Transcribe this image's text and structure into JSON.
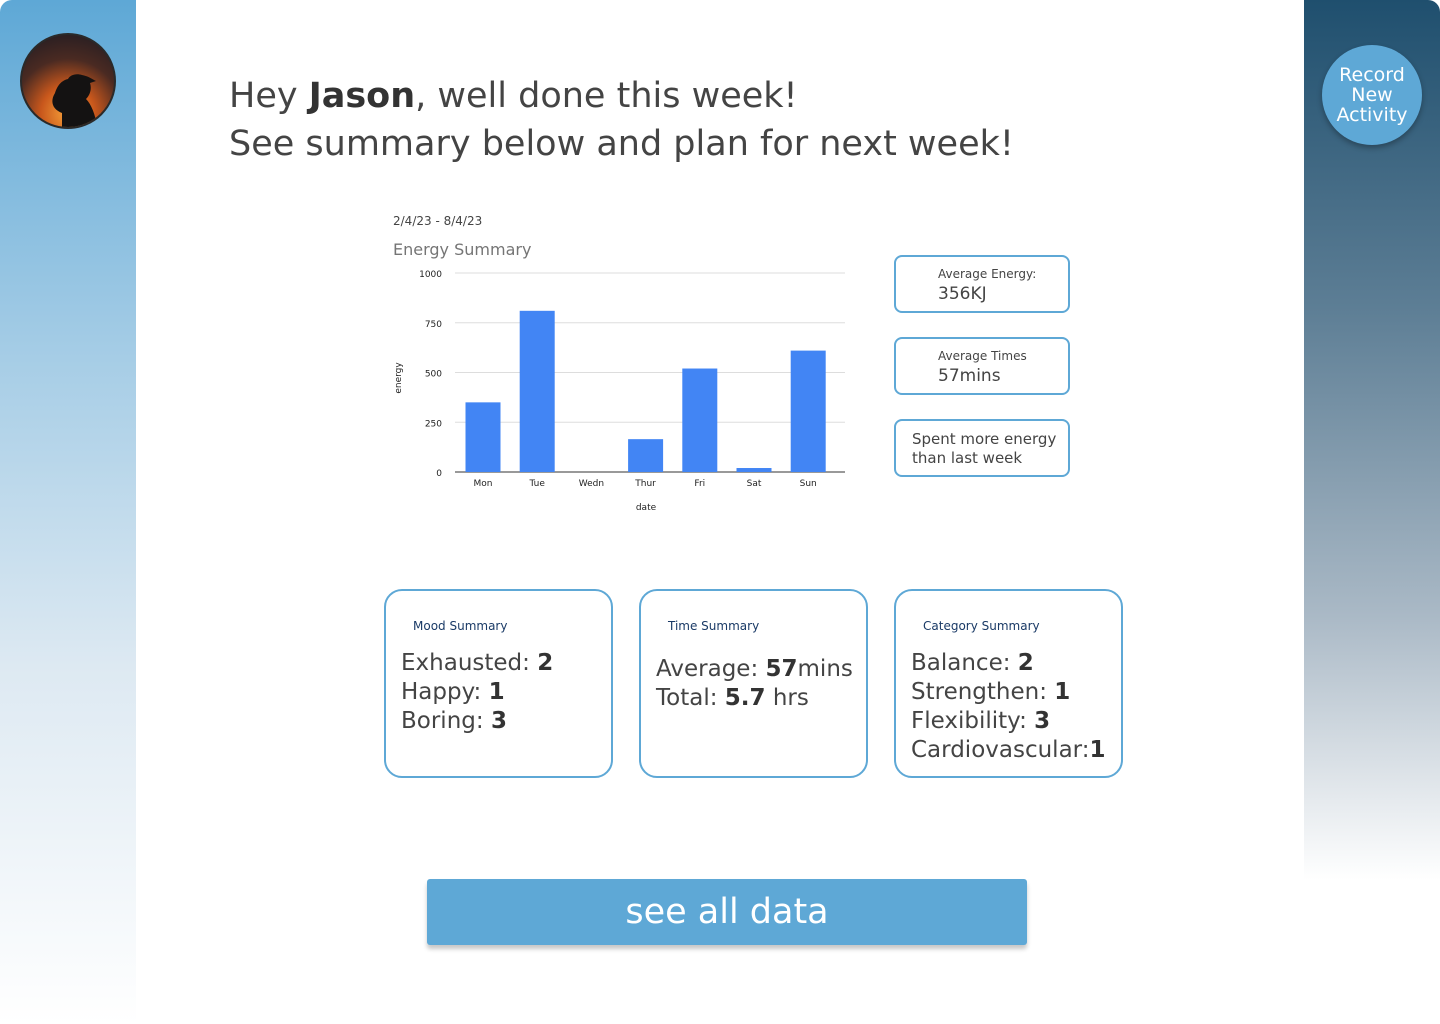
{
  "user": {
    "name": "Jason"
  },
  "greeting": {
    "prefix": "Hey ",
    "suffix": ", well done this week!",
    "line2": "See summary below and plan for next week!"
  },
  "record_button": {
    "line1": "Record",
    "line2": "New",
    "line3": "Activity"
  },
  "date_range": "2/4/23 - 8/4/23",
  "chart_data": {
    "type": "bar",
    "title": "Energy Summary",
    "xlabel": "date",
    "ylabel": "energy",
    "categories": [
      "Mon",
      "Tue",
      "Wedn",
      "Thur",
      "Fri",
      "Sat",
      "Sun"
    ],
    "values": [
      350,
      810,
      0,
      165,
      520,
      20,
      610
    ],
    "ylim": [
      0,
      1000
    ],
    "yticks": [
      0,
      250,
      500,
      750,
      1000
    ],
    "grid": true,
    "bar_color": "#4285f4"
  },
  "stats": {
    "avg_energy_label": "Average Energy:",
    "avg_energy_value": "356KJ",
    "avg_times_label": "Average Times",
    "avg_times_value": "57mins",
    "comparison": "Spent more energy than last week"
  },
  "mood_summary": {
    "title": "Mood Summary",
    "items": [
      {
        "label": "Exhausted: ",
        "value": "2"
      },
      {
        "label": "Happy: ",
        "value": "1"
      },
      {
        "label": "Boring: ",
        "value": "3"
      }
    ]
  },
  "time_summary": {
    "title": "Time Summary",
    "average_label": "Average: ",
    "average_value": "57",
    "average_unit": "mins",
    "total_label": "Total: ",
    "total_value": "5.7",
    "total_unit": " hrs"
  },
  "category_summary": {
    "title": "Category Summary",
    "items": [
      {
        "label": "Balance: ",
        "value": "2"
      },
      {
        "label": "Strengthen: ",
        "value": "1"
      },
      {
        "label": "Flexibility: ",
        "value": "3"
      },
      {
        "label": "Cardiovascular:",
        "value": "1"
      }
    ]
  },
  "see_all_label": "see all data",
  "colors": {
    "accent": "#5ea8d6",
    "bar": "#4285f4"
  }
}
